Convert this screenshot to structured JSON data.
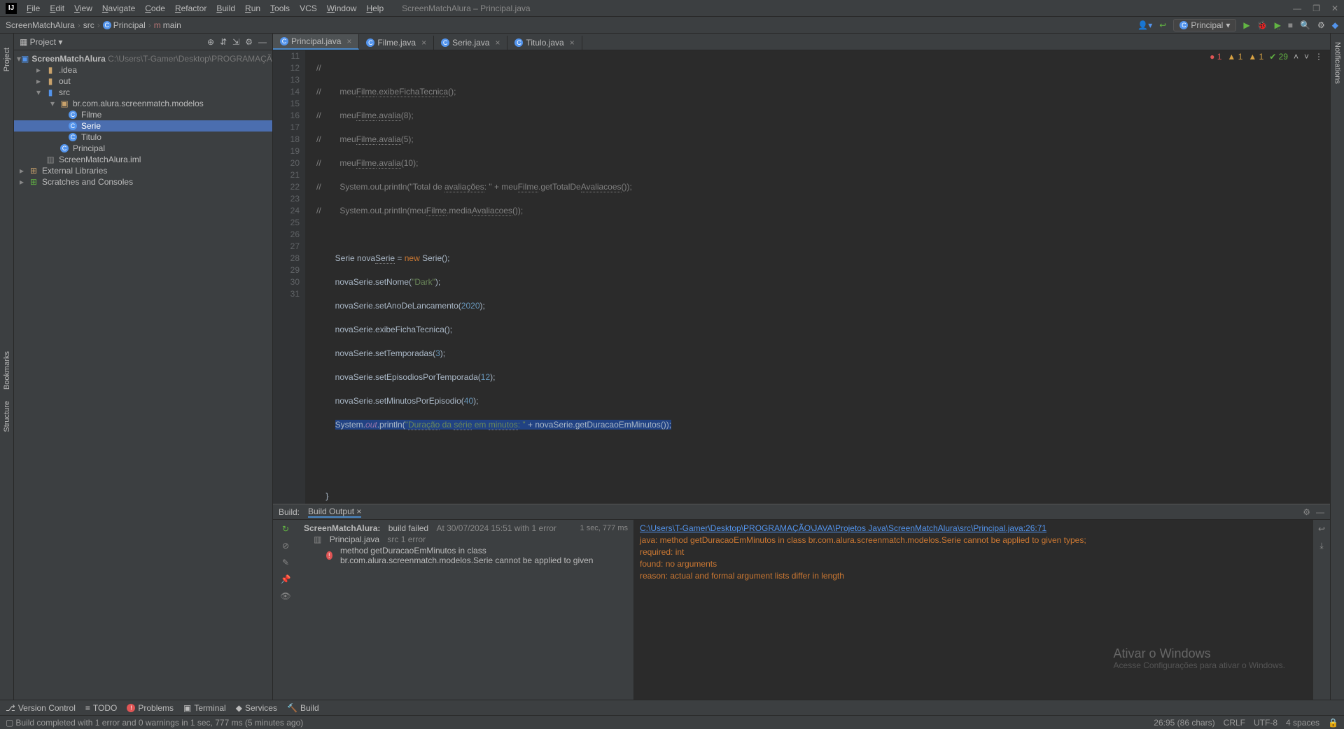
{
  "menu": [
    "File",
    "Edit",
    "View",
    "Navigate",
    "Code",
    "Refactor",
    "Build",
    "Run",
    "Tools",
    "VCS",
    "Window",
    "Help"
  ],
  "window_title": "ScreenMatchAlura – Principal.java",
  "breadcrumb": {
    "project": "ScreenMatchAlura",
    "src": "src",
    "class": "Principal",
    "method": "main"
  },
  "run_config": "Principal",
  "project_panel": {
    "label": "Project",
    "root": "ScreenMatchAlura",
    "root_path": "C:\\Users\\T-Gamer\\Desktop\\PROGRAMAÇÃO\\JAVA\\Projetos Ja",
    "idea": ".idea",
    "out": "out",
    "src": "src",
    "package": "br.com.alura.screenmatch.modelos",
    "filme": "Filme",
    "serie": "Serie",
    "titulo": "Titulo",
    "principal": "Principal",
    "iml": "ScreenMatchAlura.iml",
    "ext": "External Libraries",
    "scratches": "Scratches and Consoles"
  },
  "tabs": [
    {
      "label": "Principal.java",
      "active": true
    },
    {
      "label": "Filme.java",
      "active": false
    },
    {
      "label": "Serie.java",
      "active": false
    },
    {
      "label": "Titulo.java",
      "active": false
    }
  ],
  "editor_status": {
    "errors": "1",
    "warnings": "1",
    "weak_warnings": "1",
    "ok": "29"
  },
  "code": {
    "lines_start": 11,
    "lines_end": 31
  },
  "build": {
    "tab_build": "Build:",
    "tab_output": "Build Output",
    "project_row": "ScreenMatchAlura:",
    "project_status": "build failed",
    "project_time": "At 30/07/2024 15:51 with 1 error",
    "duration": "1 sec, 777 ms",
    "file_row": "Principal.java",
    "file_loc": "src 1 error",
    "error_row": "method getDuracaoEmMinutos in class br.com.alura.screenmatch.modelos.Serie cannot be applied to given",
    "output_link": "C:\\Users\\T-Gamer\\Desktop\\PROGRAMAÇÃO\\JAVA\\Projetos Java\\ScreenMatchAlura\\src\\Principal.java:26:71",
    "output_l1": "java: method getDuracaoEmMinutos in class br.com.alura.screenmatch.modelos.Serie cannot be applied to given types;",
    "output_l2": "  required: int",
    "output_l3": "  found:    no arguments",
    "output_l4": "  reason: actual and formal argument lists differ in length"
  },
  "bottom_tabs": {
    "vc": "Version Control",
    "todo": "TODO",
    "problems": "Problems",
    "terminal": "Terminal",
    "services": "Services",
    "build": "Build"
  },
  "status": {
    "msg": "Build completed with 1 error and 0 warnings in 1 sec, 777 ms (5 minutes ago)",
    "pos": "26:95 (86 chars)",
    "le": "CRLF",
    "enc": "UTF-8",
    "indent": "4 spaces"
  },
  "watermark": {
    "l1": "Ativar o Windows",
    "l2": "Acesse Configurações para ativar o Windows."
  },
  "sidebar_labels": {
    "project": "Project",
    "bookmarks": "Bookmarks",
    "structure": "Structure",
    "notifications": "Notifications"
  }
}
